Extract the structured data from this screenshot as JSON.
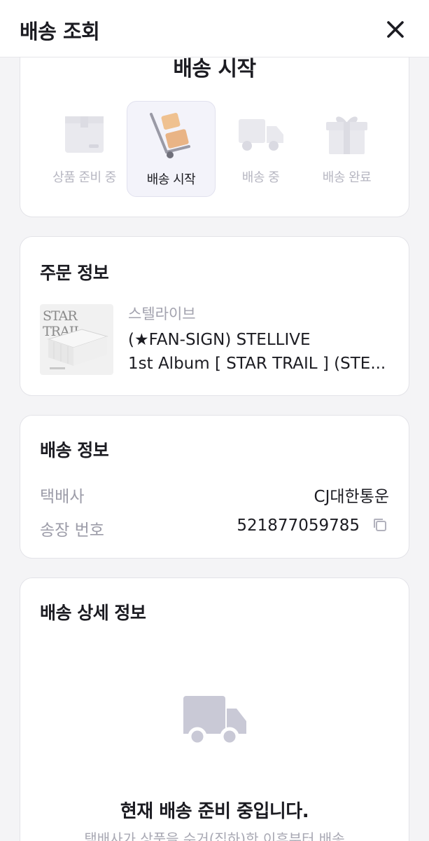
{
  "header": {
    "title": "배송 조회",
    "close_icon": "close-icon"
  },
  "status": {
    "current_title": "배송 시작",
    "steps": [
      {
        "label": "상품 준비 중",
        "icon": "box-icon",
        "active": false
      },
      {
        "label": "배송 시작",
        "icon": "hand-truck-icon",
        "active": true
      },
      {
        "label": "배송 중",
        "icon": "truck-icon",
        "active": false
      },
      {
        "label": "배송 완료",
        "icon": "gift-icon",
        "active": false
      }
    ]
  },
  "order": {
    "title": "주문 정보",
    "thumbnail_text": "STAR TRAIL",
    "brand": "스텔라이브",
    "product_line1": "(★FAN-SIGN) STELLIVE",
    "product_line2": "1st Album [ STAR TRAIL ] (STE..."
  },
  "shipping": {
    "title": "배송 정보",
    "carrier_label": "택배사",
    "carrier_value": "CJ대한통운",
    "tracking_label": "송장 번호",
    "tracking_value": "521877059785"
  },
  "detail": {
    "title": "배송 상세 정보",
    "empty_title": "현재 배송 준비 중입니다.",
    "empty_desc": "택배사가 상품을 수거(집하)한 이후부터 배송"
  },
  "colors": {
    "accent_box": "#e8b98a",
    "inactive_icon": "#e4e4ea",
    "truck_gray": "#c9c9d6",
    "active_bg": "#f3f3fa"
  }
}
